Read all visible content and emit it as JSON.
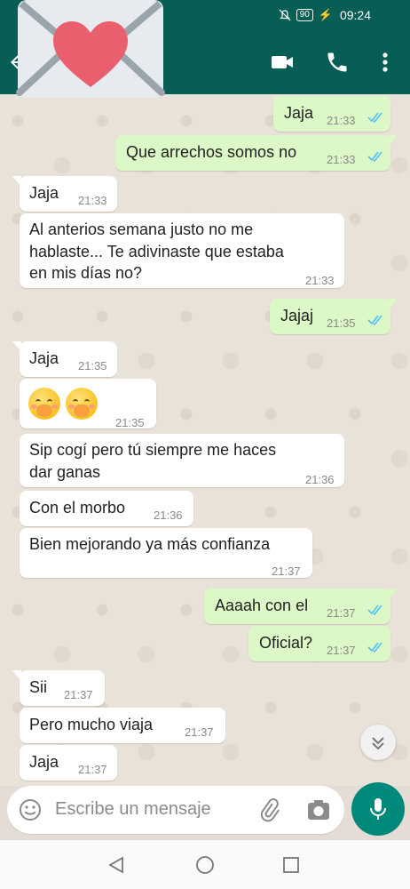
{
  "status_bar": {
    "battery": "90",
    "time": "09:24"
  },
  "messages": [
    {
      "dir": "out",
      "text": "Jaja",
      "time": "21:33"
    },
    {
      "dir": "out",
      "text": "Que arrechos somos no",
      "time": "21:33"
    },
    {
      "dir": "in",
      "text": "Jaja",
      "time": "21:33"
    },
    {
      "dir": "in",
      "lines": [
        "Al anterios semana justo no me",
        "hablaste... Te adivinaste que estaba",
        "en mis días no?"
      ],
      "time": "21:33"
    },
    {
      "dir": "out",
      "text": "Jajaj",
      "time": "21:35"
    },
    {
      "dir": "in",
      "text": "Jaja",
      "time": "21:35"
    },
    {
      "dir": "in",
      "emoji": "face-with-hand-over-mouth x2",
      "time": "21:35"
    },
    {
      "dir": "in",
      "lines": [
        "Sip cogí pero tú siempre me haces",
        "dar ganas"
      ],
      "time": "21:36"
    },
    {
      "dir": "in",
      "text": "Con el morbo",
      "time": "21:36"
    },
    {
      "dir": "in",
      "text": "Bien mejorando ya más confianza",
      "time": "21:37"
    },
    {
      "dir": "out",
      "text": "Aaaah con el",
      "time": "21:37"
    },
    {
      "dir": "out",
      "text": "Oficial?",
      "time": "21:37"
    },
    {
      "dir": "in",
      "text": "Sii",
      "time": "21:37"
    },
    {
      "dir": "in",
      "text": "Pero mucho viaja",
      "time": "21:37"
    },
    {
      "dir": "in",
      "text": "Jaja",
      "time": "21:37"
    }
  ],
  "input": {
    "placeholder": "Escribe un mensaje"
  },
  "colors": {
    "header": "#075e54",
    "outgoing": "#dcf8c6",
    "incoming": "#ffffff",
    "tick_read": "#4fc3f7",
    "mic": "#00897b"
  }
}
